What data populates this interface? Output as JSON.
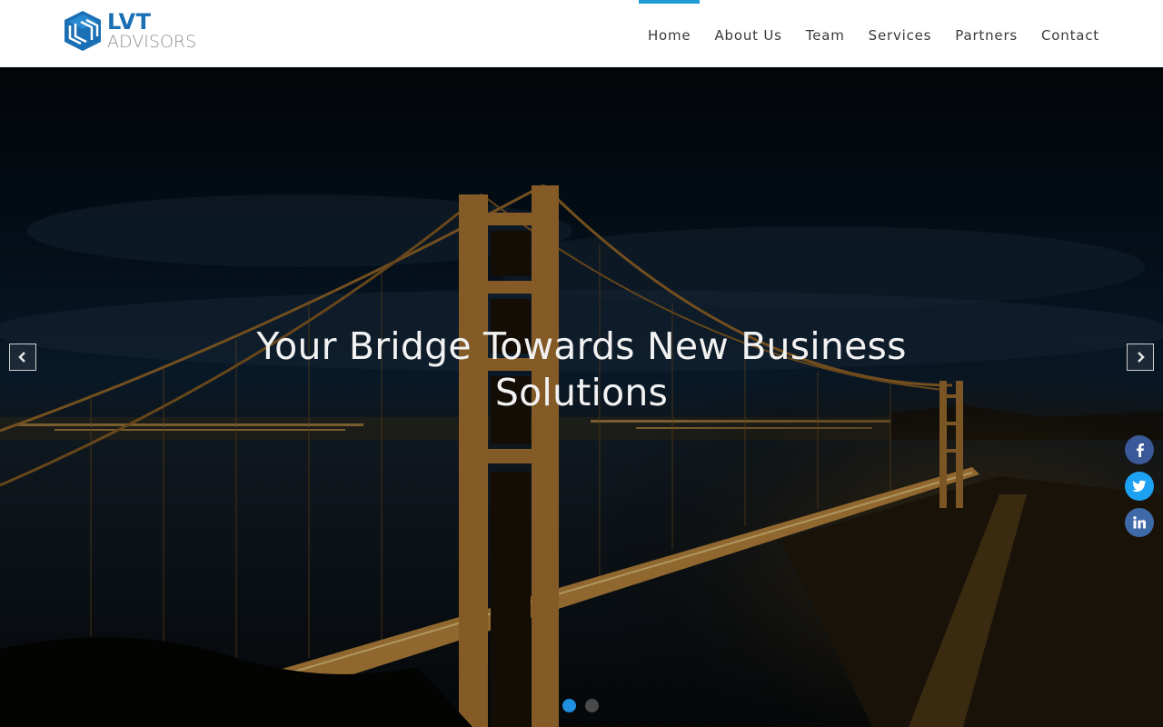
{
  "brand": {
    "name_top": "LVT",
    "name_bottom": "ADVISORS",
    "logo_icon": "cube-logo-icon",
    "primary_color": "#1a6fb5",
    "accent_color": "#1f9bd8"
  },
  "nav": {
    "items": [
      {
        "label": "Home",
        "active": true
      },
      {
        "label": "About Us",
        "active": false
      },
      {
        "label": "Team",
        "active": false
      },
      {
        "label": "Services",
        "active": false
      },
      {
        "label": "Partners",
        "active": false
      },
      {
        "label": "Contact",
        "active": false
      }
    ]
  },
  "hero": {
    "title": "Your Bridge Towards New Business Solutions",
    "prev_icon": "chevron-left-icon",
    "next_icon": "chevron-right-icon",
    "slides_total": 2,
    "active_slide": 1,
    "background": "night-bridge-photo"
  },
  "social": [
    {
      "name": "facebook",
      "icon": "facebook-icon",
      "color": "#3b5998"
    },
    {
      "name": "twitter",
      "icon": "twitter-icon",
      "color": "#1da1f2"
    },
    {
      "name": "linkedin",
      "icon": "linkedin-icon",
      "color": "#3f6aa8"
    }
  ]
}
